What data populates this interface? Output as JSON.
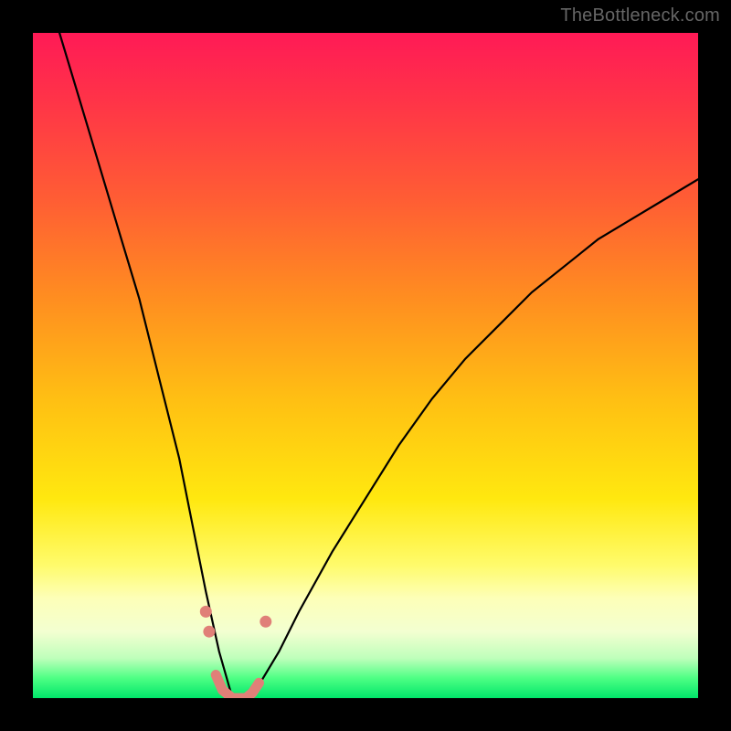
{
  "watermark": "TheBottleneck.com",
  "colors": {
    "frame_bg": "#000000",
    "watermark": "#666666",
    "curve": "#000000",
    "marker": "#e08078",
    "gradient_top": "#ff1a56",
    "gradient_mid": "#ffe80f",
    "gradient_bottom": "#00e66a"
  },
  "chart_data": {
    "type": "line",
    "title": "",
    "xlabel": "",
    "ylabel": "",
    "xlim": [
      0,
      100
    ],
    "ylim": [
      0,
      100
    ],
    "grid": false,
    "legend": false,
    "note": "No axis ticks or numeric labels are rendered in the image; x/y scales are normalized 0–100. The curve is V-shaped with a minimum (~0) near x≈30; values are estimated from pixel positions.",
    "series": [
      {
        "name": "bottleneck-curve",
        "x": [
          4,
          7,
          10,
          13,
          16,
          19,
          22,
          24,
          26,
          28,
          30,
          32,
          34,
          37,
          40,
          45,
          50,
          55,
          60,
          65,
          70,
          75,
          80,
          85,
          90,
          95,
          100
        ],
        "y": [
          100,
          90,
          80,
          70,
          60,
          48,
          36,
          26,
          16,
          7,
          0,
          0,
          2,
          7,
          13,
          22,
          30,
          38,
          45,
          51,
          56,
          61,
          65,
          69,
          72,
          75,
          78
        ]
      }
    ],
    "markers": [
      {
        "name": "left-dot-upper",
        "x": 26.0,
        "y": 13.0
      },
      {
        "name": "left-dot-lower",
        "x": 26.5,
        "y": 10.0
      },
      {
        "name": "right-dot",
        "x": 35.0,
        "y": 11.5
      }
    ],
    "trough_band": {
      "name": "trough-highlight",
      "x": [
        27.5,
        28.5,
        30,
        32,
        33,
        34
      ],
      "y": [
        3.5,
        1.2,
        0,
        0,
        0.8,
        2.3
      ]
    }
  }
}
